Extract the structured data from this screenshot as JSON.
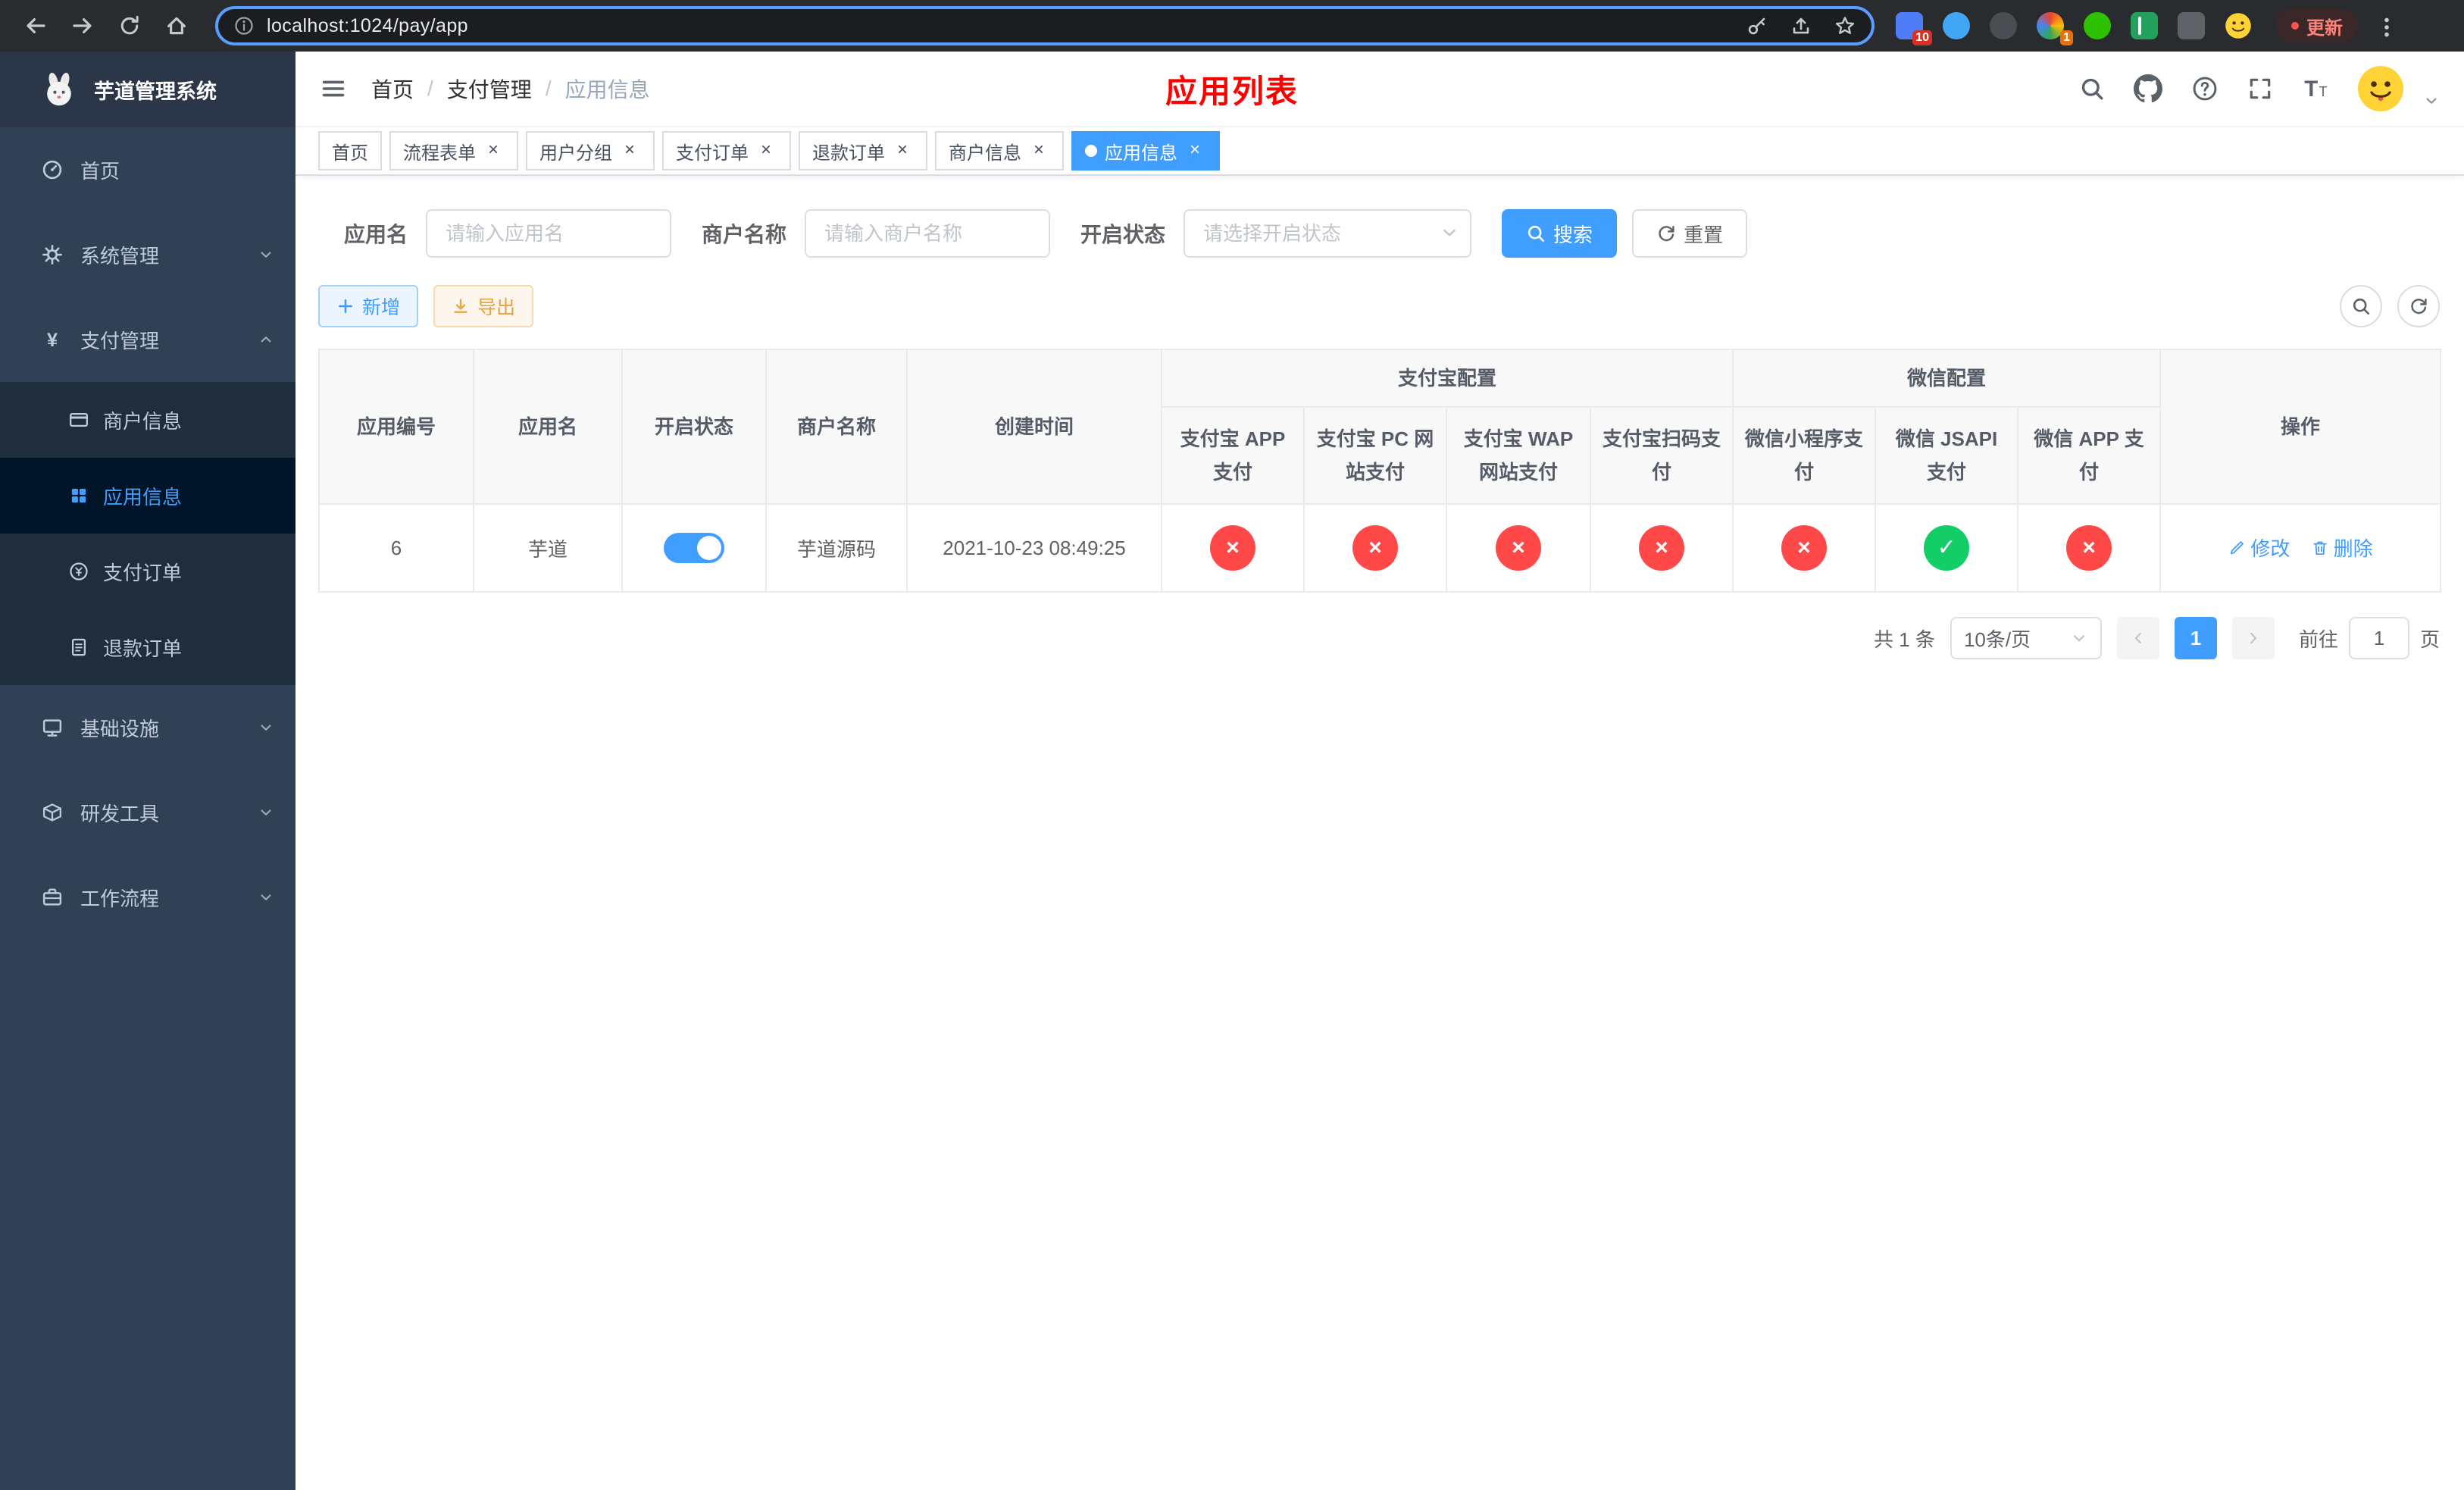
{
  "browser": {
    "url": "localhost:1024/pay/app",
    "update_label": "更新",
    "ext_badge_1": "10",
    "ext_badge_2": "1"
  },
  "sidebar": {
    "logo_title": "芋道管理系统",
    "items": [
      {
        "label": "首页"
      },
      {
        "label": "系统管理"
      },
      {
        "label": "支付管理",
        "children": [
          {
            "label": "商户信息"
          },
          {
            "label": "应用信息"
          },
          {
            "label": "支付订单"
          },
          {
            "label": "退款订单"
          }
        ]
      },
      {
        "label": "基础设施"
      },
      {
        "label": "研发工具"
      },
      {
        "label": "工作流程"
      }
    ]
  },
  "header": {
    "breadcrumb": [
      "首页",
      "支付管理",
      "应用信息"
    ],
    "title": "应用列表"
  },
  "tabs": [
    {
      "label": "首页"
    },
    {
      "label": "流程表单"
    },
    {
      "label": "用户分组"
    },
    {
      "label": "支付订单"
    },
    {
      "label": "退款订单"
    },
    {
      "label": "商户信息"
    },
    {
      "label": "应用信息"
    }
  ],
  "filter": {
    "app_name_label": "应用名",
    "app_name_placeholder": "请输入应用名",
    "merchant_name_label": "商户名称",
    "merchant_name_placeholder": "请输入商户名称",
    "status_label": "开启状态",
    "status_placeholder": "请选择开启状态",
    "search_label": "搜索",
    "reset_label": "重置"
  },
  "toolbar": {
    "add_label": "新增",
    "export_label": "导出"
  },
  "table": {
    "headers": {
      "app_id": "应用编号",
      "app_name": "应用名",
      "status": "开启状态",
      "merchant_name": "商户名称",
      "create_time": "创建时间",
      "alipay_group": "支付宝配置",
      "wechat_group": "微信配置",
      "alipay_app": "支付宝 APP 支付",
      "alipay_pc": "支付宝 PC 网站支付",
      "alipay_wap": "支付宝 WAP 网站支付",
      "alipay_qr": "支付宝扫码支付",
      "wechat_mini": "微信小程序支付",
      "wechat_jsapi": "微信 JSAPI 支付",
      "wechat_app": "微信 APP 支付",
      "actions": "操作"
    },
    "rows": [
      {
        "app_id": "6",
        "app_name": "芋道",
        "status_on": true,
        "merchant_name": "芋道源码",
        "create_time": "2021-10-23 08:49:25",
        "configs": [
          false,
          false,
          false,
          false,
          false,
          true,
          false
        ],
        "edit_label": "修改",
        "delete_label": "删除"
      }
    ]
  },
  "pagination": {
    "total": "共 1 条",
    "page_size": "10条/页",
    "current_page": "1",
    "goto_label": "前往",
    "goto_value": "1",
    "unit_label": "页"
  },
  "colors": {
    "primary": "#409eff",
    "success": "#13ce66",
    "danger": "#ff4949",
    "warning": "#e6a23c",
    "title_red": "#ff0000"
  }
}
